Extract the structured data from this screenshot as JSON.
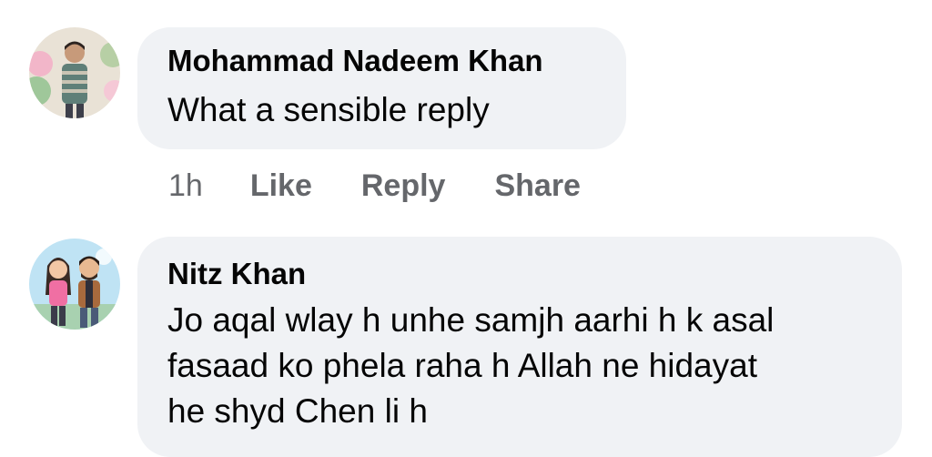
{
  "comments": [
    {
      "author": "Mohammad Nadeem Khan",
      "text": "What a sensible reply",
      "actions": {
        "time": "1h",
        "like": "Like",
        "reply": "Reply",
        "share": "Share"
      }
    },
    {
      "author": "Nitz Khan",
      "text_lines": [
        "Jo aqal wlay h unhe samjh aarhi h k asal",
        "fasaad ko phela raha h Allah ne hidayat",
        "he shyd Chen li h"
      ]
    }
  ],
  "colors": {
    "bubble": "#f0f2f5",
    "text": "#050505",
    "secondary": "#65676b"
  }
}
